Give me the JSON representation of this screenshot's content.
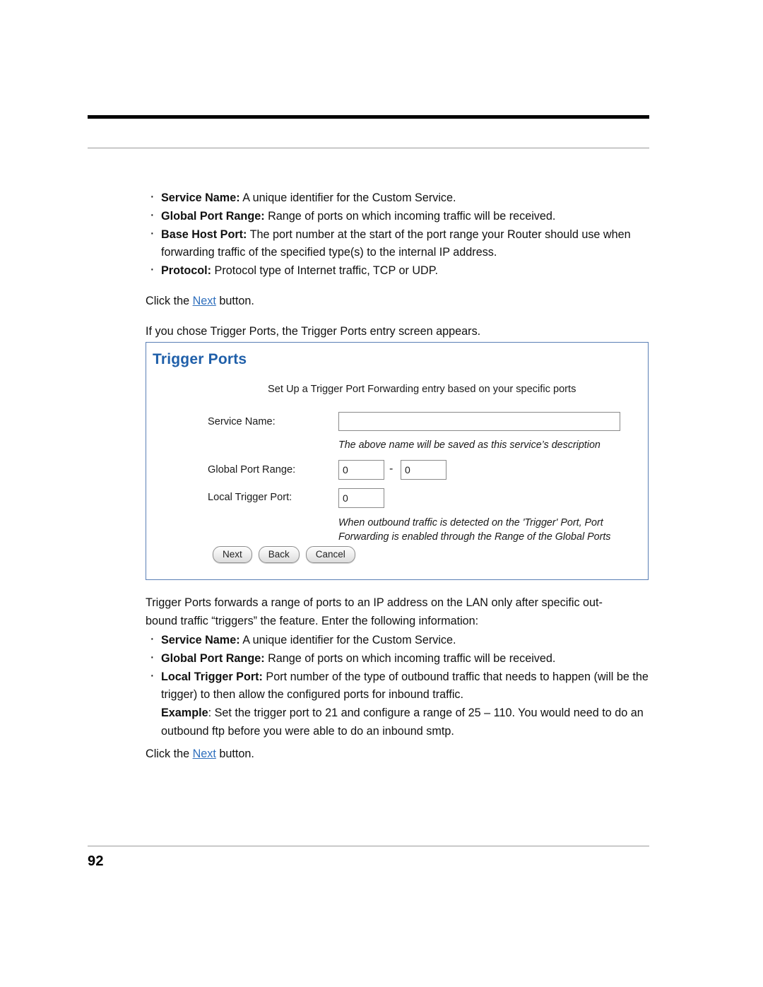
{
  "page": {
    "number": "92"
  },
  "top_section": {
    "bullets": [
      {
        "term": "Service Name:",
        "text": " A unique identifier for the Custom Service."
      },
      {
        "term": "Global Port Range:",
        "text": " Range of ports on which incoming traffic will be received."
      },
      {
        "term": "Base Host Port:",
        "text": " The port number at the start of the port range your Router should use when forwarding traffic of the specified type(s) to the internal IP address."
      },
      {
        "term": "Protocol:",
        "text": " Protocol type of Internet traffic, TCP or UDP."
      }
    ],
    "click_prefix": "Click the ",
    "click_link": "Next",
    "click_suffix": " button.",
    "intro": "If you chose Trigger Ports, the Trigger Ports entry screen appears."
  },
  "figure": {
    "title": "Trigger Ports",
    "subtitle": "Set Up a Trigger Port Forwarding entry based on your specific ports",
    "labels": {
      "service_name": "Service Name:",
      "global_port_range": "Global Port Range:",
      "local_trigger_port": "Local Trigger Port:"
    },
    "fields": {
      "service_name_value": "",
      "service_name_placeholder": "",
      "global_port_start": "0",
      "global_port_end": "0",
      "range_separator": "-",
      "local_trigger_port": "0"
    },
    "notes": {
      "service_note": "The above name will be saved as this service’s description",
      "trigger_note_line1": "When outbound traffic is detected on the 'Trigger' Port, Port",
      "trigger_note_line2": "Forwarding is enabled through the Range of the Global Ports"
    },
    "buttons": {
      "next": "Next",
      "back": "Back",
      "cancel": "Cancel"
    },
    "colors": {
      "title": "#1f5fa9",
      "border": "#5a7fb5"
    }
  },
  "bottom_section": {
    "paragraph_line1": "Trigger Ports forwards a range of ports to an IP address on the LAN only after specific out-",
    "paragraph_line2": "bound traffic “triggers” the feature. Enter the following information:",
    "bullets": [
      {
        "term": "Service Name:",
        "text": " A unique identifier for the Custom Service."
      },
      {
        "term": "Global Port Range:",
        "text": " Range of ports on which incoming traffic will be received."
      },
      {
        "term": "Local Trigger Port:",
        "text": " Port number of the type of outbound traffic that needs to happen (will be the trigger) to then allow the configured ports for inbound traffic."
      }
    ],
    "example_term": "Example",
    "example_text": ": Set the trigger port to 21 and configure a range of 25 – 110. You would need to do an outbound ftp before you were able to do an inbound smtp.",
    "click_prefix": "Click the ",
    "click_link": "Next",
    "click_suffix": " button."
  }
}
